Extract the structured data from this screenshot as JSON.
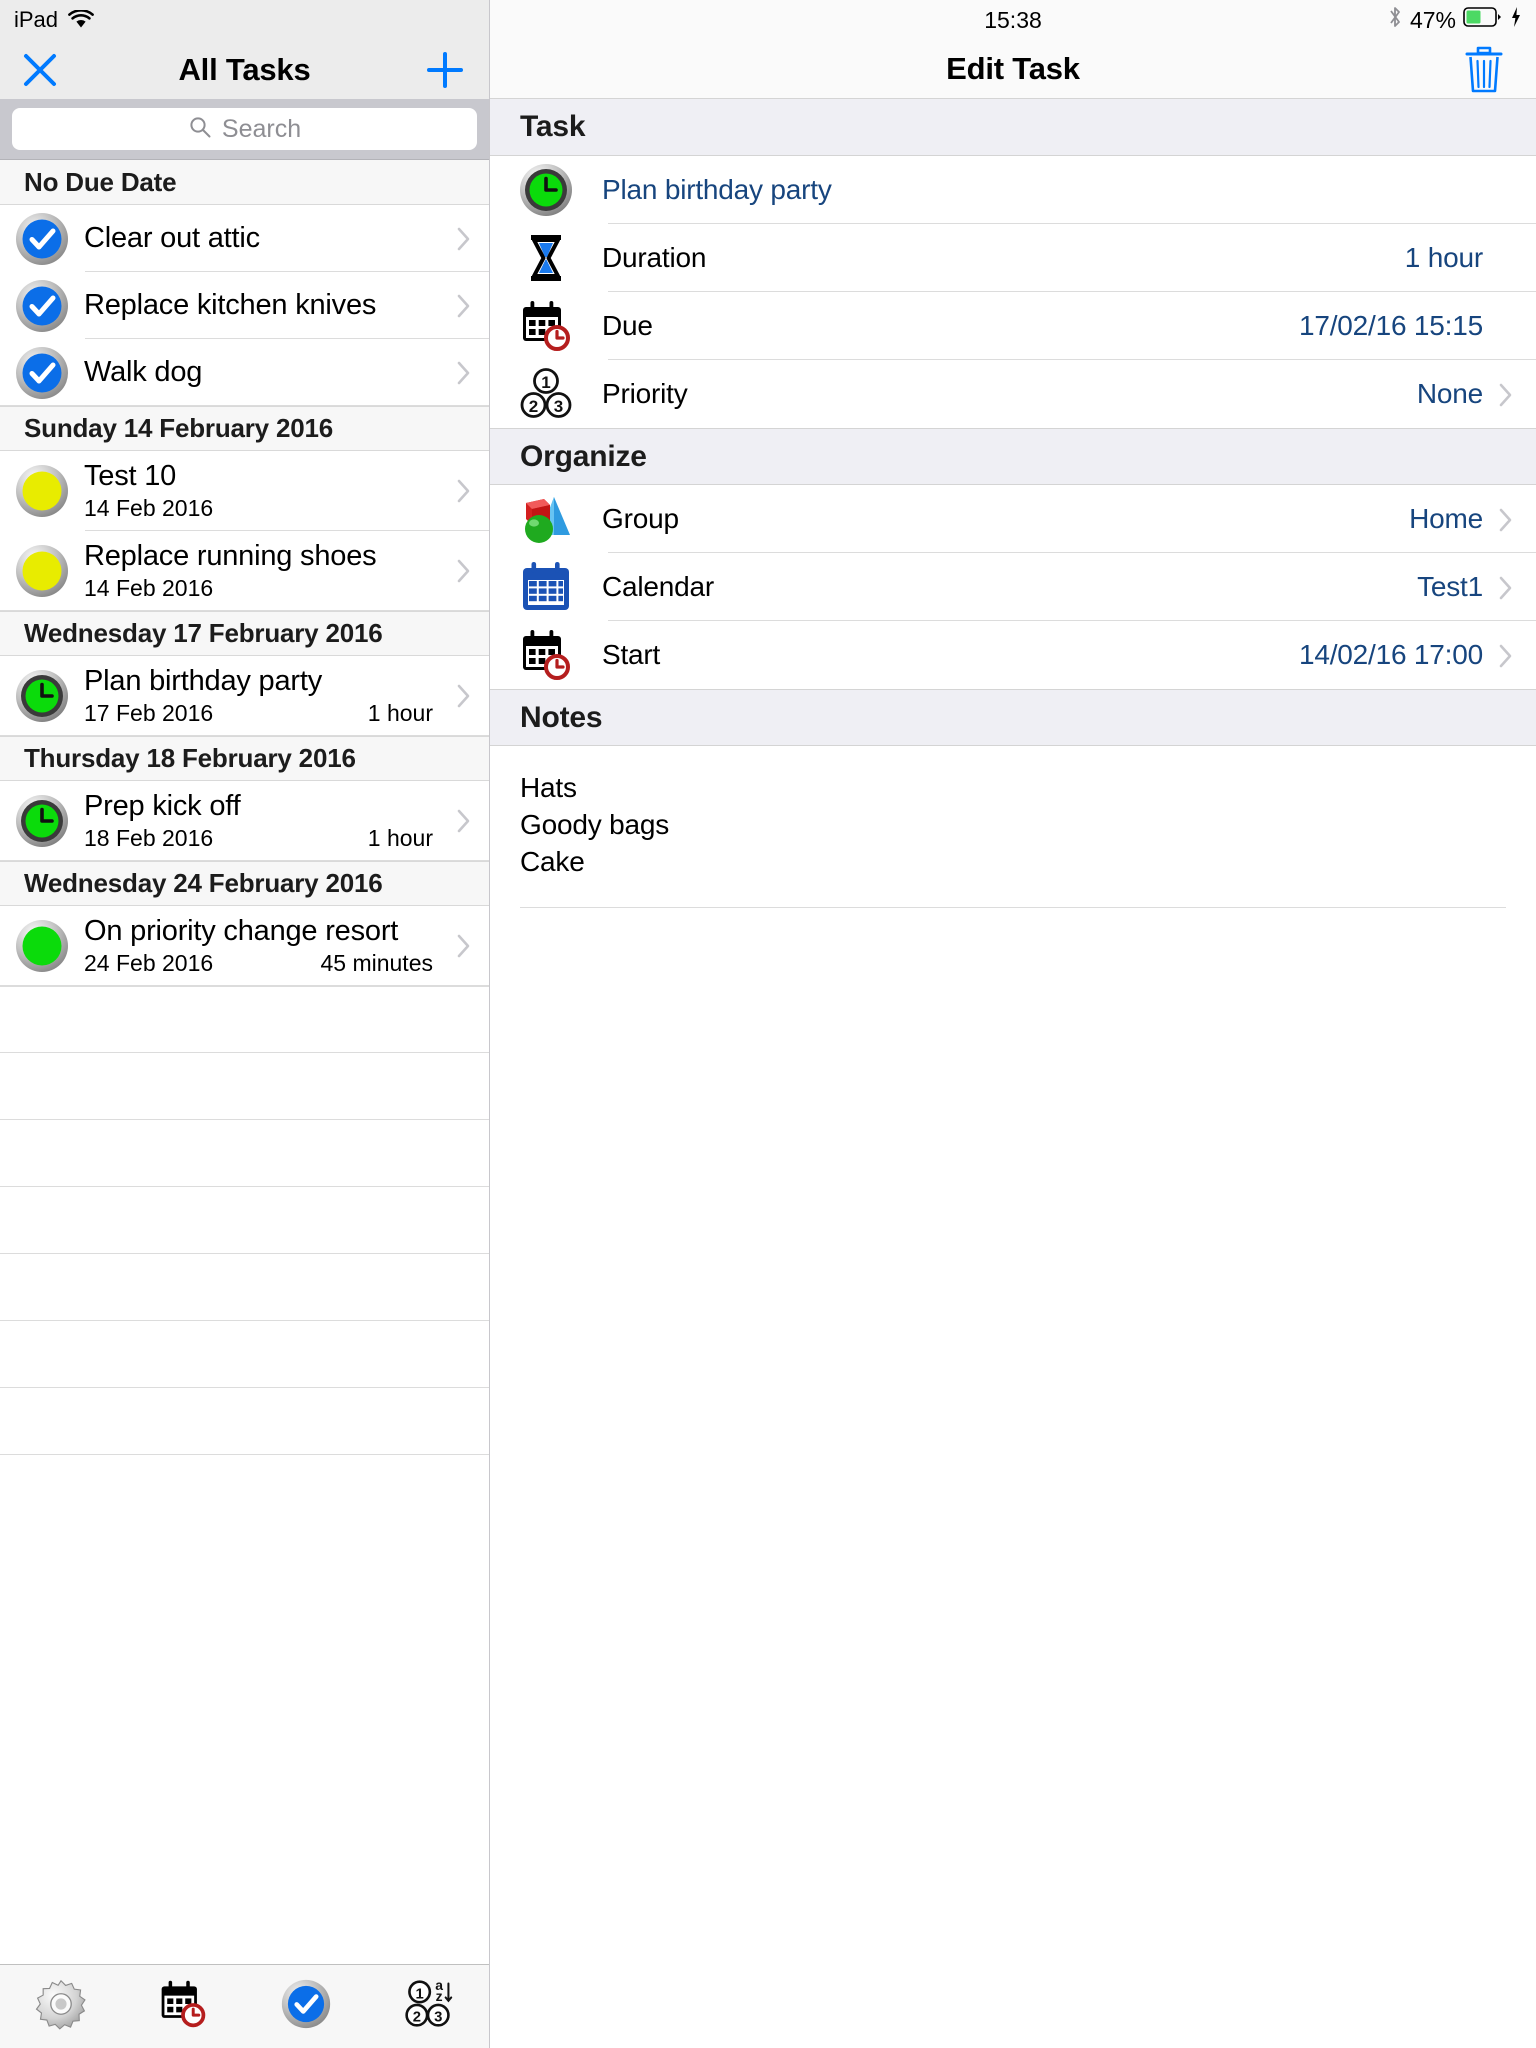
{
  "left": {
    "statusbar": {
      "device": "iPad",
      "wifi_icon": "wifi-icon"
    },
    "navbar": {
      "title": "All Tasks",
      "close_icon": "close-icon",
      "add_icon": "plus-icon"
    },
    "search": {
      "placeholder": "Search",
      "icon": "search-icon"
    },
    "sections": [
      {
        "header": "No Due Date",
        "rows": [
          {
            "title": "Clear out attic",
            "date": "",
            "duration": "",
            "icon": "checkmark-blue-icon"
          },
          {
            "title": "Replace kitchen knives",
            "date": "",
            "duration": "",
            "icon": "checkmark-blue-icon"
          },
          {
            "title": "Walk dog",
            "date": "",
            "duration": "",
            "icon": "checkmark-blue-icon"
          }
        ]
      },
      {
        "header": "Sunday 14 February 2016",
        "rows": [
          {
            "title": "Test 10",
            "date": "14 Feb 2016",
            "duration": "",
            "icon": "status-yellow-icon"
          },
          {
            "title": "Replace running shoes",
            "date": "14 Feb 2016",
            "duration": "",
            "icon": "status-yellow-icon"
          }
        ]
      },
      {
        "header": "Wednesday 17 February 2016",
        "rows": [
          {
            "title": "Plan birthday party",
            "date": "17 Feb 2016",
            "duration": "1 hour",
            "icon": "clock-green-icon"
          }
        ]
      },
      {
        "header": "Thursday 18 February 2016",
        "rows": [
          {
            "title": "Prep kick off",
            "date": "18 Feb 2016",
            "duration": "1 hour",
            "icon": "clock-green-icon"
          }
        ]
      },
      {
        "header": "Wednesday 24 February 2016",
        "rows": [
          {
            "title": "On priority change resort",
            "date": "24 Feb 2016",
            "duration": "45 minutes",
            "icon": "status-green-icon"
          }
        ]
      }
    ],
    "tabbar": [
      {
        "icon": "gear-icon",
        "name": "tab-settings"
      },
      {
        "icon": "calendar-clock-icon",
        "name": "tab-calendar"
      },
      {
        "icon": "checkmark-blue-icon",
        "name": "tab-tasks"
      },
      {
        "icon": "priority-sort-icon",
        "name": "tab-priority"
      }
    ]
  },
  "right": {
    "statusbar": {
      "time": "15:38",
      "bluetooth_icon": "bluetooth-icon",
      "battery_pct": "47%",
      "battery_icon": "battery-icon",
      "charging_icon": "lightning-icon"
    },
    "navbar": {
      "title": "Edit Task",
      "trash_icon": "trash-icon"
    },
    "groups": [
      {
        "header": "Task",
        "rows": [
          {
            "icon": "clock-green-icon",
            "label": "Plan birthday party",
            "label_is_link": true,
            "value": "",
            "chevron": false
          },
          {
            "icon": "hourglass-icon",
            "label": "Duration",
            "label_is_link": false,
            "value": "1 hour",
            "chevron": false
          },
          {
            "icon": "calendar-clock-icon",
            "label": "Due",
            "label_is_link": false,
            "value": "17/02/16 15:15",
            "chevron": false
          },
          {
            "icon": "priority-123-icon",
            "label": "Priority",
            "label_is_link": false,
            "value": "None",
            "chevron": true
          }
        ]
      },
      {
        "header": "Organize",
        "rows": [
          {
            "icon": "shapes-group-icon",
            "label": "Group",
            "label_is_link": false,
            "value": "Home",
            "chevron": true
          },
          {
            "icon": "calendar-blue-icon",
            "label": "Calendar",
            "label_is_link": false,
            "value": "Test1",
            "chevron": true
          },
          {
            "icon": "calendar-clock-icon",
            "label": "Start",
            "label_is_link": false,
            "value": "14/02/16 17:00",
            "chevron": true
          }
        ]
      }
    ],
    "notes": {
      "header": "Notes",
      "text": "Hats\nGoody bags\nCake"
    }
  },
  "colors": {
    "accent_blue": "#007aff",
    "value_blue": "#17457e",
    "status_yellow": "#e8ec00",
    "status_green": "#0bdb0b",
    "section_grey": "#efeff4",
    "search_bar_grey": "#c8c8ce",
    "nav_grey": "#ececec",
    "separator": "#dcdcdc",
    "calendar_red": "#b51e1e",
    "calendar_blue": "#1b52b5"
  }
}
